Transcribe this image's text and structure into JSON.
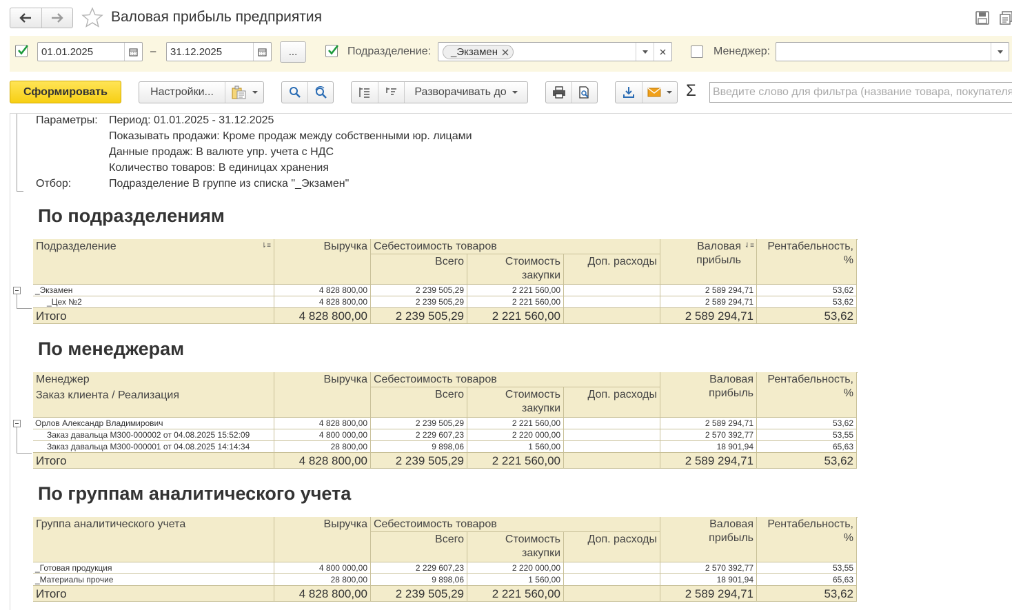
{
  "window": {
    "title": "Валовая прибыль предприятия"
  },
  "filters": {
    "period_enabled": true,
    "date_from": "01.01.2025",
    "date_separator": "–",
    "date_to": "31.12.2025",
    "more_button": "...",
    "subdivision_enabled": true,
    "subdivision_label": "Подразделение:",
    "subdivision_tag": "_Экзамен",
    "manager_enabled": false,
    "manager_label": "Менеджер:",
    "manager_value": ""
  },
  "toolbar": {
    "generate": "Сформировать",
    "settings": "Настройки...",
    "expand_to": "Разворачивать до",
    "sigma": "Σ",
    "search_placeholder": "Введите слово для фильтра (название товара, покупателя"
  },
  "params": {
    "label_params": "Параметры:",
    "period": "Период: 01.01.2025 - 31.12.2025",
    "show_sales": "Показывать продажи: Кроме продаж между собственными юр. лицами",
    "sales_data": "Данные продаж: В валюте упр. учета с НДС",
    "goods_qty": "Количество товаров: В единицах хранения",
    "label_filter": "Отбор:",
    "filter": "Подразделение В группе из списка \"_Экзамен\""
  },
  "headers": {
    "revenue": "Выручка",
    "cost": "Себестоимость товаров",
    "cost_total": "Всего",
    "cost_purchase_1": "Стоимость",
    "cost_purchase_2": "закупки",
    "extra": "Доп. расходы",
    "gross_1": "Валовая",
    "gross_2": "прибыль",
    "margin_1": "Рентабельность,",
    "margin_2": "%"
  },
  "sections": [
    {
      "title": "По подразделениям",
      "col1_header": "Подразделение",
      "col1_header2": "",
      "rows": [
        {
          "name": "_Экзамен",
          "revenue": "4 828 800,00",
          "cost_total": "2 239 505,29",
          "cost_purchase": "2 221 560,00",
          "extra": "",
          "gross": "2 589 294,71",
          "margin": "53,62"
        },
        {
          "name": "_Цех №2",
          "revenue": "4 828 800,00",
          "cost_total": "2 239 505,29",
          "cost_purchase": "2 221 560,00",
          "extra": "",
          "gross": "2 589 294,71",
          "margin": "53,62"
        }
      ],
      "total": {
        "name": "Итого",
        "revenue": "4 828 800,00",
        "cost_total": "2 239 505,29",
        "cost_purchase": "2 221 560,00",
        "extra": "",
        "gross": "2 589 294,71",
        "margin": "53,62"
      }
    },
    {
      "title": "По менеджерам",
      "col1_header": "Менеджер",
      "col1_header2": "Заказ клиента / Реализация",
      "rows": [
        {
          "name": "Орлов Александр Владимирович",
          "revenue": "4 828 800,00",
          "cost_total": "2 239 505,29",
          "cost_purchase": "2 221 560,00",
          "extra": "",
          "gross": "2 589 294,71",
          "margin": "53,62"
        },
        {
          "name": "Заказ давальца М300-000002 от 04.08.2025 15:52:09",
          "revenue": "4 800 000,00",
          "cost_total": "2 229 607,23",
          "cost_purchase": "2 220 000,00",
          "extra": "",
          "gross": "2 570 392,77",
          "margin": "53,55"
        },
        {
          "name": "Заказ давальца М300-000001 от 04.08.2025 14:14:34",
          "revenue": "28 800,00",
          "cost_total": "9 898,06",
          "cost_purchase": "1 560,00",
          "extra": "",
          "gross": "18 901,94",
          "margin": "65,63"
        }
      ],
      "total": {
        "name": "Итого",
        "revenue": "4 828 800,00",
        "cost_total": "2 239 505,29",
        "cost_purchase": "2 221 560,00",
        "extra": "",
        "gross": "2 589 294,71",
        "margin": "53,62"
      }
    },
    {
      "title": "По группам аналитического учета",
      "col1_header": "Группа аналитического учета",
      "col1_header2": "",
      "rows": [
        {
          "name": "_Готовая продукция",
          "revenue": "4 800 000,00",
          "cost_total": "2 229 607,23",
          "cost_purchase": "2 220 000,00",
          "extra": "",
          "gross": "2 570 392,77",
          "margin": "53,55"
        },
        {
          "name": "_Материалы прочие",
          "revenue": "28 800,00",
          "cost_total": "9 898,06",
          "cost_purchase": "1 560,00",
          "extra": "",
          "gross": "18 901,94",
          "margin": "65,63"
        }
      ],
      "total": {
        "name": "Итого",
        "revenue": "4 828 800,00",
        "cost_total": "2 239 505,29",
        "cost_purchase": "2 221 560,00",
        "extra": "",
        "gross": "2 589 294,71",
        "margin": "53,62"
      }
    }
  ]
}
